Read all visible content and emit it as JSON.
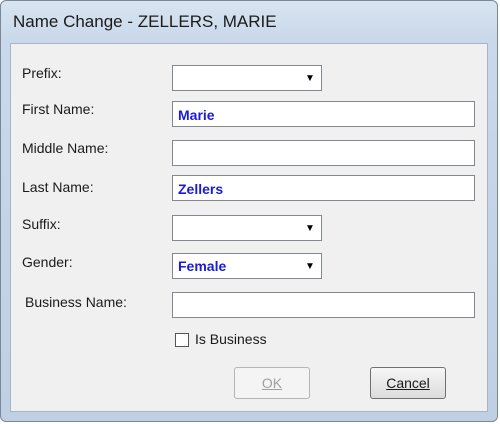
{
  "window": {
    "title": "Name Change - ZELLERS, MARIE"
  },
  "form": {
    "prefix": {
      "label": "Prefix:",
      "value": ""
    },
    "first_name": {
      "label": "First Name:",
      "value": "Marie"
    },
    "middle_name": {
      "label": "Middle Name:",
      "value": ""
    },
    "last_name": {
      "label": "Last Name:",
      "value": "Zellers"
    },
    "suffix": {
      "label": "Suffix:",
      "value": ""
    },
    "gender": {
      "label": "Gender:",
      "value": "Female"
    },
    "business_name": {
      "label": "Business Name:",
      "value": ""
    },
    "is_business": {
      "label": "Is Business",
      "checked": false
    }
  },
  "buttons": {
    "ok_label": "OK",
    "cancel_label": "Cancel",
    "ok_enabled": false
  },
  "icons": {
    "dropdown": "chevron-down-icon"
  },
  "colors": {
    "value_text": "#1b1bd6",
    "client_bg": "#f0f0f0"
  }
}
